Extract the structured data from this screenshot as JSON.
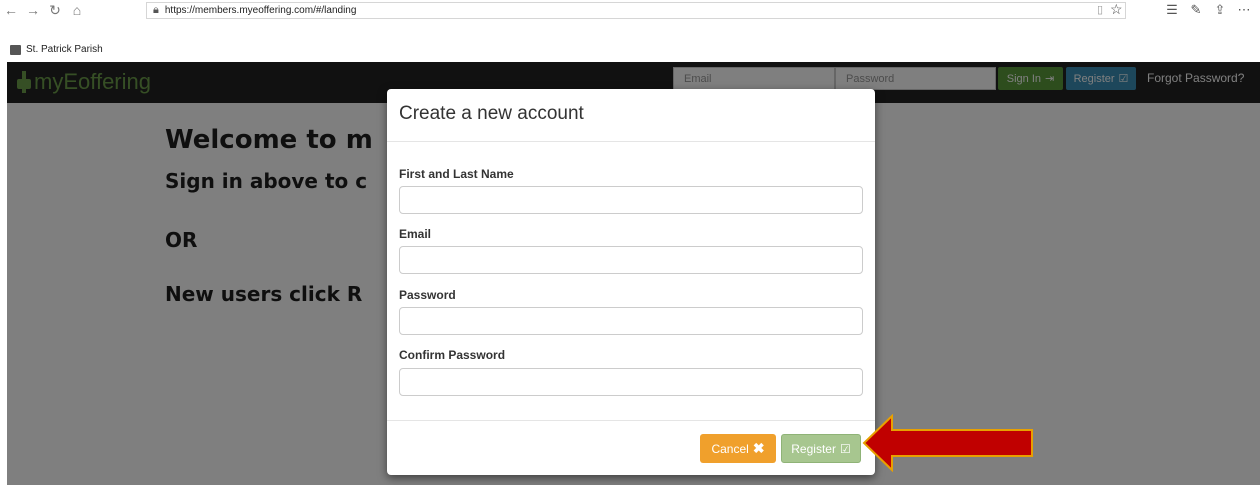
{
  "browser": {
    "url": "https://members.myeoffering.com/#/landing",
    "bookmark": "St. Patrick Parish"
  },
  "site": {
    "logo_text": "myEoffering",
    "email_placeholder": "Email",
    "password_placeholder": "Password",
    "sign_in_label": "Sign In",
    "register_label": "Register",
    "forgot_label": "Forgot Password?",
    "colors": {
      "header": "#222222",
      "brand": "#6c9e4a",
      "sign_in": "#5a9a3a",
      "register": "#3a8fb7"
    }
  },
  "landing": {
    "line1": "Welcome to m",
    "line2": "Sign in above to c",
    "line3": "OR",
    "line4": "New users click R"
  },
  "modal": {
    "title": "Create a new account",
    "fields": [
      {
        "label": "First and Last Name",
        "value": ""
      },
      {
        "label": "Email",
        "value": ""
      },
      {
        "label": "Password",
        "value": ""
      },
      {
        "label": "Confirm Password",
        "value": ""
      }
    ],
    "cancel_label": "Cancel",
    "register_label": "Register",
    "colors": {
      "cancel": "#f0a02c",
      "register": "#8ab36a"
    }
  },
  "annotation": {
    "arrow_color": "#c00000",
    "arrow_outline": "#e8a000"
  }
}
